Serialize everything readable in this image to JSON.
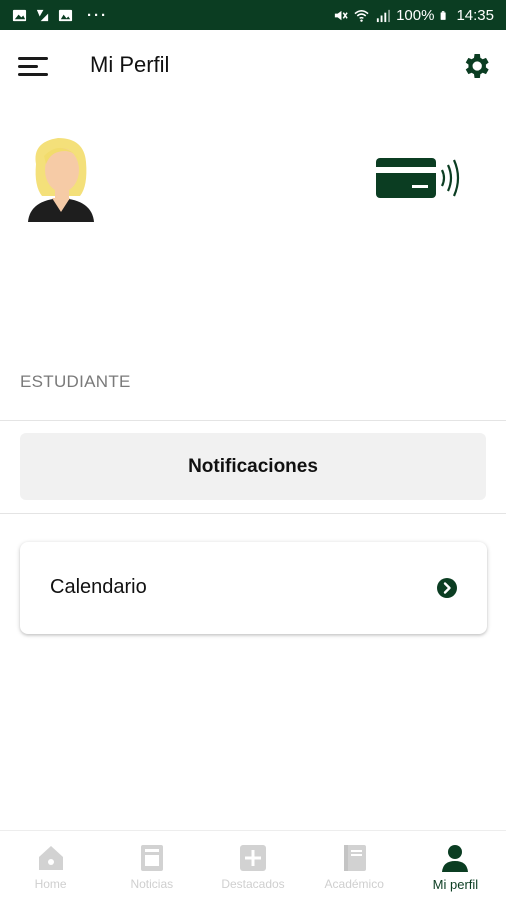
{
  "status_bar": {
    "battery": "100%",
    "time": "14:35",
    "more": "···"
  },
  "app_bar": {
    "title": "Mi Perfil"
  },
  "profile": {
    "role": "ESTUDIANTE"
  },
  "actions": {
    "notifications_label": "Notificaciones",
    "calendar_label": "Calendario"
  },
  "bottom_nav": {
    "items": [
      {
        "label": "Home",
        "icon": "home-icon"
      },
      {
        "label": "Noticias",
        "icon": "news-icon"
      },
      {
        "label": "Destacados",
        "icon": "plus-square-icon"
      },
      {
        "label": "Académico",
        "icon": "book-icon"
      },
      {
        "label": "Mi perfil",
        "icon": "person-icon"
      }
    ],
    "active_index": 4
  },
  "colors": {
    "brand_green": "#0b3d22",
    "inactive_icon": "#d2d2d2"
  }
}
